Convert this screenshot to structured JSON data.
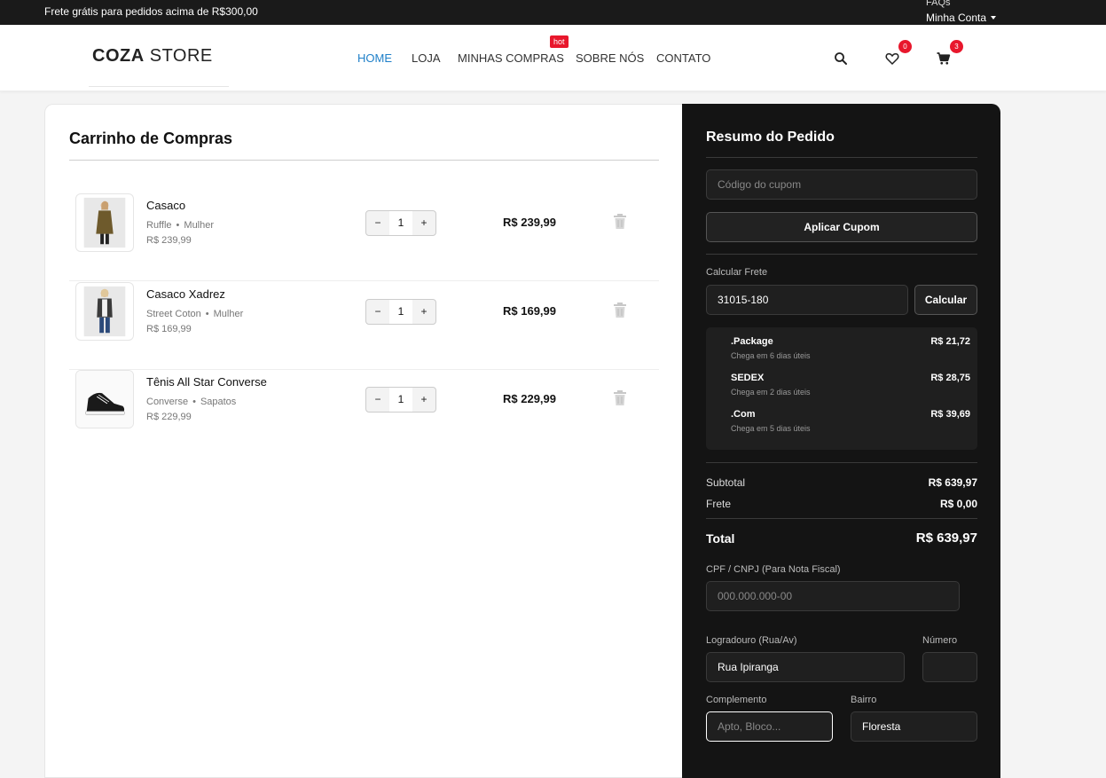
{
  "topbar": {
    "promo": "Frete grátis para pedidos acima de R$300,00",
    "faqs": "FAQs",
    "account": "Minha Conta"
  },
  "header": {
    "logo_bold": "COZA",
    "logo_light": " STORE",
    "nav": [
      "HOME",
      "LOJA",
      "MINHAS COMPRAS",
      "SOBRE NÓS",
      "CONTATO"
    ],
    "hot_badge": "hot",
    "wishlist_count": "0",
    "cart_count": "3",
    "accent_color": "#1f80c9",
    "badge_color": "#e8172c"
  },
  "cart": {
    "title": "Carrinho de Compras",
    "items": [
      {
        "name": "Casaco",
        "brand": "Ruffle",
        "category": "Mulher",
        "unit_price": "R$ 239,99",
        "qty": "1",
        "total": "R$ 239,99",
        "image_icon": "coat-model-icon"
      },
      {
        "name": "Casaco Xadrez",
        "brand": "Street Coton",
        "category": "Mulher",
        "unit_price": "R$ 169,99",
        "qty": "1",
        "total": "R$ 169,99",
        "image_icon": "plaid-coat-model-icon"
      },
      {
        "name": "Tênis All Star Converse",
        "brand": "Converse",
        "category": "Sapatos",
        "unit_price": "R$ 229,99",
        "qty": "1",
        "total": "R$ 229,99",
        "image_icon": "sneaker-icon"
      }
    ],
    "minus": "−",
    "plus": "+",
    "dot": "•"
  },
  "summary": {
    "title": "Resumo do Pedido",
    "coupon_placeholder": "Código do cupom",
    "apply_coupon": "Aplicar Cupom",
    "shipping_label": "Calcular Frete",
    "zip_value": "31015-180",
    "calc_button": "Calcular",
    "shipping_options": [
      {
        "name": ".Package",
        "desc": "Chega em 6 dias úteis",
        "price": "R$ 21,72"
      },
      {
        "name": "SEDEX",
        "desc": "Chega em 2 dias úteis",
        "price": "R$ 28,75"
      },
      {
        "name": ".Com",
        "desc": "Chega em 5 dias úteis",
        "price": "R$ 39,69"
      }
    ],
    "subtotal_label": "Subtotal",
    "subtotal_value": "R$ 639,97",
    "freight_label": "Frete",
    "freight_value": "R$ 0,00",
    "total_label": "Total",
    "total_value": "R$ 639,97",
    "cpf_label": "CPF / CNPJ (Para Nota Fiscal)",
    "cpf_placeholder": "000.000.000-00",
    "street_label": "Logradouro (Rua/Av)",
    "street_value": "Rua Ipiranga",
    "number_label": "Número",
    "number_value": "",
    "complement_label": "Complemento",
    "complement_placeholder": "Apto, Bloco...",
    "district_label": "Bairro",
    "district_value": "Floresta"
  }
}
